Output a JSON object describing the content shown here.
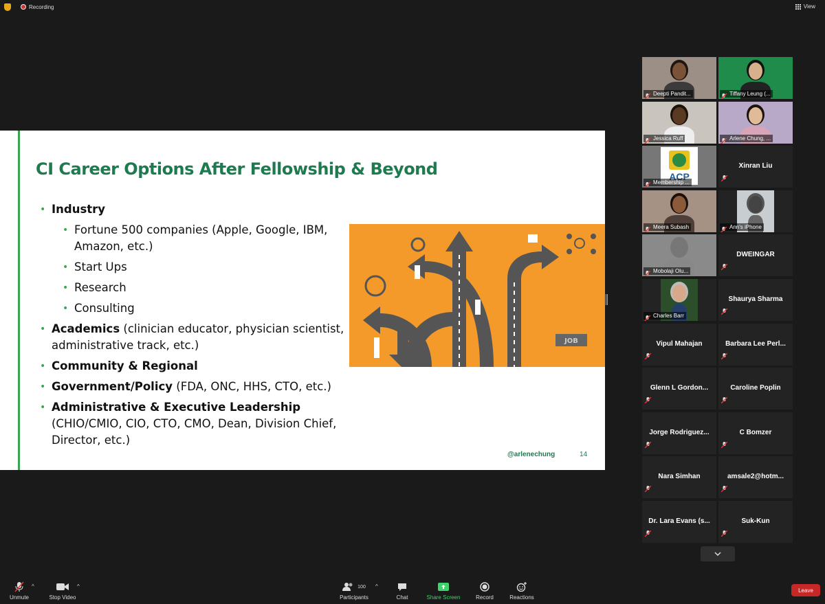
{
  "topbar": {
    "recording_label": "Recording",
    "view_label": "View"
  },
  "slide": {
    "title": "CI Career Options After Fellowship & Beyond",
    "industry": "Industry",
    "industry_items": [
      "Fortune 500 companies (Apple, Google, IBM, Amazon, etc.)",
      "Start Ups",
      "Research",
      "Consulting"
    ],
    "academics_bold": "Academics",
    "academics_rest": " (clinician educator, physician scientist, administrative track, etc.)",
    "community": "Community & Regional",
    "government_bold": "Government/Policy",
    "government_rest": " (FDA, ONC, HHS, CTO, etc.)",
    "admin_bold": "Administrative & Executive Leadership",
    "admin_rest": " (CHIO/CMIO, CIO, CTO, CMO, Dean, Division Chief, Director, etc.)",
    "handle": "@arlenechung",
    "page_number": "14",
    "art_sign": "JOB"
  },
  "participants": [
    {
      "name": "Deepti Pandit...",
      "type": "video"
    },
    {
      "name": "Tiffany Leung (...",
      "type": "video"
    },
    {
      "name": "Jessica Ruff",
      "type": "video"
    },
    {
      "name": "Arlene Chung, ...",
      "type": "video",
      "active": true
    },
    {
      "name": "Membership ...",
      "type": "logo"
    },
    {
      "name": "Xinran Liu",
      "type": "name"
    },
    {
      "name": "Meera Subash",
      "type": "video"
    },
    {
      "name": "Ann's iPhone",
      "type": "video"
    },
    {
      "name": "Mobolaji Olu...",
      "type": "video"
    },
    {
      "name": "DWEINGAR",
      "type": "name"
    },
    {
      "name": "Charles Barr",
      "type": "video"
    },
    {
      "name": "Shaurya Sharma",
      "type": "name"
    },
    {
      "name": "Vipul Mahajan",
      "type": "name"
    },
    {
      "name": "Barbara Lee Perl...",
      "type": "name"
    },
    {
      "name": "Glenn  L  Gordon...",
      "type": "name"
    },
    {
      "name": "Caroline Poplin",
      "type": "name"
    },
    {
      "name": "Jorge  Rodriguez...",
      "type": "name"
    },
    {
      "name": "C Bomzer",
      "type": "name"
    },
    {
      "name": "Nara Simhan",
      "type": "name"
    },
    {
      "name": "amsale2@hotm...",
      "type": "name"
    },
    {
      "name": "Dr. Lara Evans (s...",
      "type": "name"
    },
    {
      "name": "Suk-Kun",
      "type": "name"
    }
  ],
  "logo_text": "ACP",
  "toolbar": {
    "unmute": "Unmute",
    "stop_video": "Stop Video",
    "participants": "Participants",
    "participants_count": "100",
    "chat": "Chat",
    "share_screen": "Share Screen",
    "record": "Record",
    "reactions": "Reactions",
    "leave": "Leave"
  },
  "colors": {
    "accent_green": "#3aa655",
    "title_green": "#1e7a4f",
    "leave_red": "#c62828",
    "share_green": "#3fd36b",
    "art_orange": "#f49a2a"
  }
}
